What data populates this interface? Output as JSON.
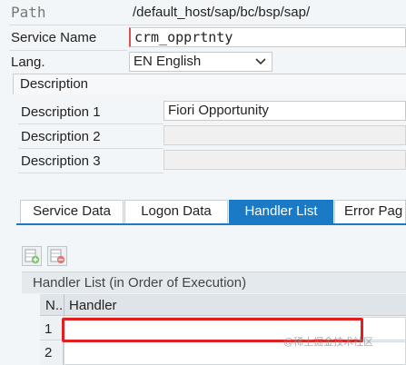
{
  "header": {
    "path_label": "Path",
    "path_value": "/default_host/sap/bc/bsp/sap/",
    "service_name_label": "Service Name",
    "service_name_value": "crm_opprtnty",
    "lang_label": "Lang.",
    "lang_value": "EN English"
  },
  "description": {
    "section_label": "Description",
    "rows": [
      {
        "label": "Description 1",
        "value": "Fiori Opportunity"
      },
      {
        "label": "Description 2",
        "value": ""
      },
      {
        "label": "Description 3",
        "value": ""
      }
    ]
  },
  "tabs": [
    {
      "label": "Service Data",
      "active": false
    },
    {
      "label": "Logon Data",
      "active": false
    },
    {
      "label": "Handler List",
      "active": true
    },
    {
      "label": "Error Pag",
      "active": false
    }
  ],
  "handler_list": {
    "title": "Handler List (in Order of Execution)",
    "columns": [
      "N..",
      "Handler"
    ],
    "rows": [
      {
        "n": "1",
        "handler": ""
      },
      {
        "n": "2",
        "handler": ""
      }
    ]
  },
  "watermark": "@稀土掘金技术社区",
  "colors": {
    "accent": "#1a7ac5",
    "highlight": "#e02020"
  }
}
